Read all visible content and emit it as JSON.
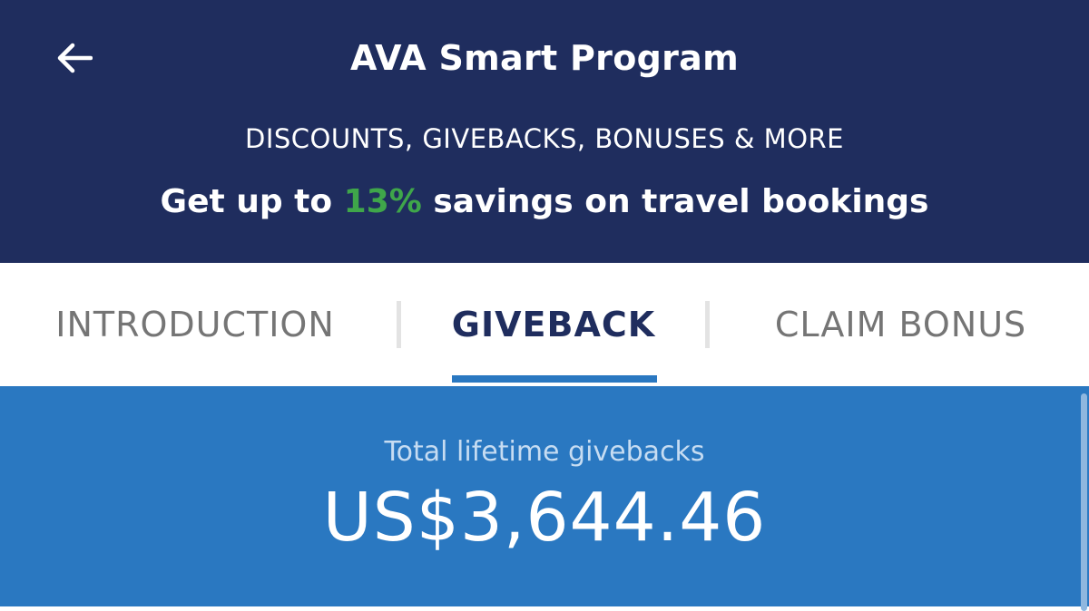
{
  "header": {
    "title": "AVA Smart Program",
    "subtitle": "DISCOUNTS, GIVEBACKS, BONUSES & MORE",
    "savings_prefix": "Get up to ",
    "savings_percent": "13%",
    "savings_suffix": " savings on travel bookings",
    "back_icon": "arrow-left-icon"
  },
  "tabs": [
    {
      "label": "INTRODUCTION",
      "active": false
    },
    {
      "label": "GIVEBACK",
      "active": true
    },
    {
      "label": "CLAIM BONUS",
      "active": false
    }
  ],
  "giveback": {
    "total_label": "Total lifetime givebacks",
    "total_value": "US$3,644.46"
  },
  "colors": {
    "header_bg": "#1f2d5e",
    "accent_green": "#3fa64a",
    "panel_blue": "#2a78c1",
    "active_tab_text": "#1f2d5e",
    "inactive_tab_text": "#757575"
  }
}
